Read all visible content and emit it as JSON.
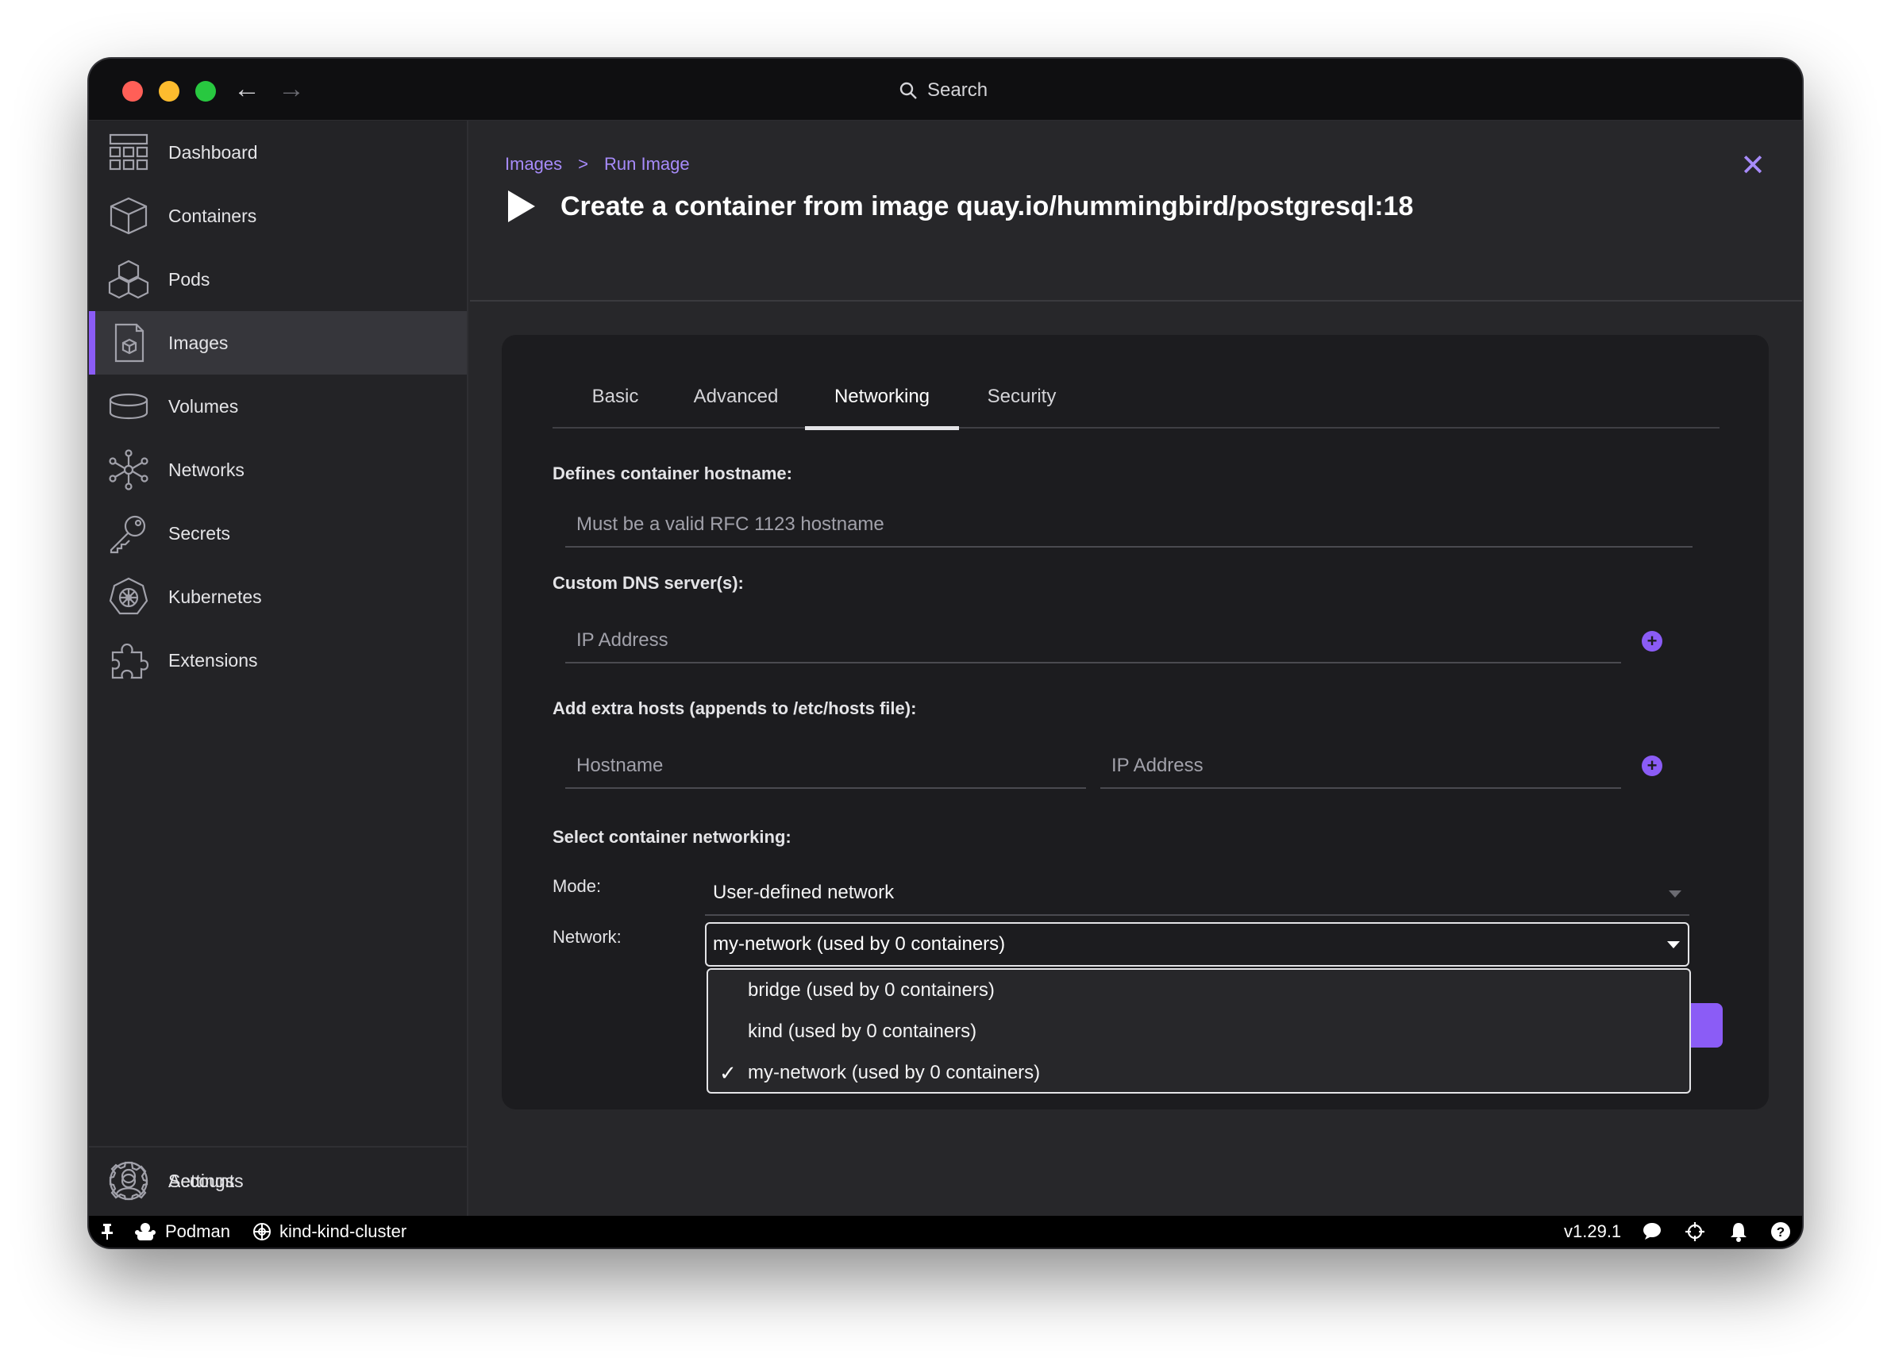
{
  "window": {
    "search_label": "Search"
  },
  "sidebar": {
    "items": [
      {
        "label": "Dashboard",
        "icon": "dashboard-icon"
      },
      {
        "label": "Containers",
        "icon": "container-icon"
      },
      {
        "label": "Pods",
        "icon": "pods-icon"
      },
      {
        "label": "Images",
        "icon": "image-icon",
        "active": true
      },
      {
        "label": "Volumes",
        "icon": "volume-icon"
      },
      {
        "label": "Networks",
        "icon": "network-icon"
      },
      {
        "label": "Secrets",
        "icon": "key-icon"
      },
      {
        "label": "Kubernetes",
        "icon": "kubernetes-icon"
      },
      {
        "label": "Extensions",
        "icon": "puzzle-icon"
      }
    ],
    "bottom_items": [
      {
        "label": "Accounts",
        "icon": "user-icon"
      },
      {
        "label": "Settings",
        "icon": "gear-icon"
      }
    ]
  },
  "header": {
    "breadcrumb": {
      "parent": "Images",
      "separator": ">",
      "current": "Run Image"
    },
    "title": "Create a container from image quay.io/hummingbird/postgresql:18"
  },
  "tabs": [
    "Basic",
    "Advanced",
    "Networking",
    "Security"
  ],
  "active_tab": "Networking",
  "form": {
    "hostname_label": "Defines container hostname:",
    "hostname_placeholder": "Must be a valid RFC 1123 hostname",
    "dns_label": "Custom DNS server(s):",
    "dns_placeholder": "IP Address",
    "extra_hosts_label": "Add extra hosts (appends to /etc/hosts file):",
    "extra_host_hostname_placeholder": "Hostname",
    "extra_host_ip_placeholder": "IP Address",
    "networking_label": "Select container networking:",
    "mode_label": "Mode:",
    "mode_value": "User-defined network",
    "network_label": "Network:",
    "network_value": "my-network (used by 0 containers)",
    "network_options": [
      {
        "label": "bridge (used by 0 containers)",
        "selected": false
      },
      {
        "label": "kind (used by 0 containers)",
        "selected": false
      },
      {
        "label": "my-network (used by 0 containers)",
        "selected": true
      }
    ],
    "check_mark": "✓"
  },
  "statusbar": {
    "engine": "Podman",
    "context": "kind-kind-cluster",
    "version": "v1.29.1"
  },
  "colors": {
    "accent": "#8b5cf6",
    "background": "#27272a",
    "sidebar": "#232326",
    "card": "#1c1c1f"
  }
}
